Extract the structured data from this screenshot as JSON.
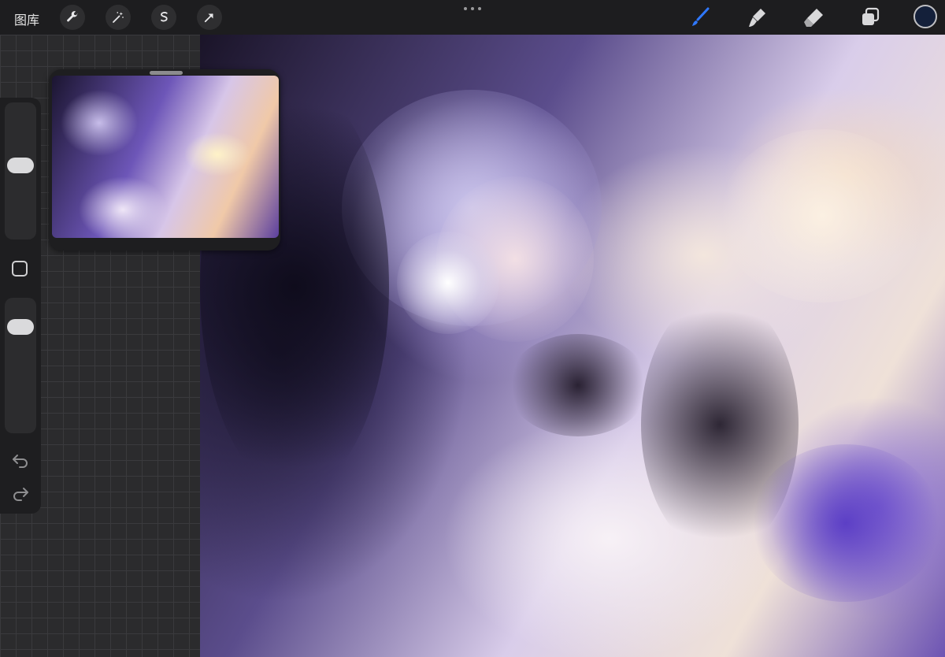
{
  "toolbar": {
    "gallery_label": "图库",
    "left_tools": [
      "wrench-icon",
      "magic-wand-icon",
      "selection-icon",
      "transform-arrow-icon"
    ],
    "right_tools": [
      "brush-icon",
      "smudge-icon",
      "eraser-icon",
      "layers-icon"
    ],
    "current_color": "#14203a",
    "active_tool_color": "#2f78ff"
  },
  "sidebar": {
    "brush_size_level": 0.55,
    "opacity_level": 0.85
  },
  "canvas": {
    "description_colors": [
      "#1a1428",
      "#5b4d8c",
      "#d9cdea",
      "#efe1d8",
      "#6d54b3"
    ]
  }
}
